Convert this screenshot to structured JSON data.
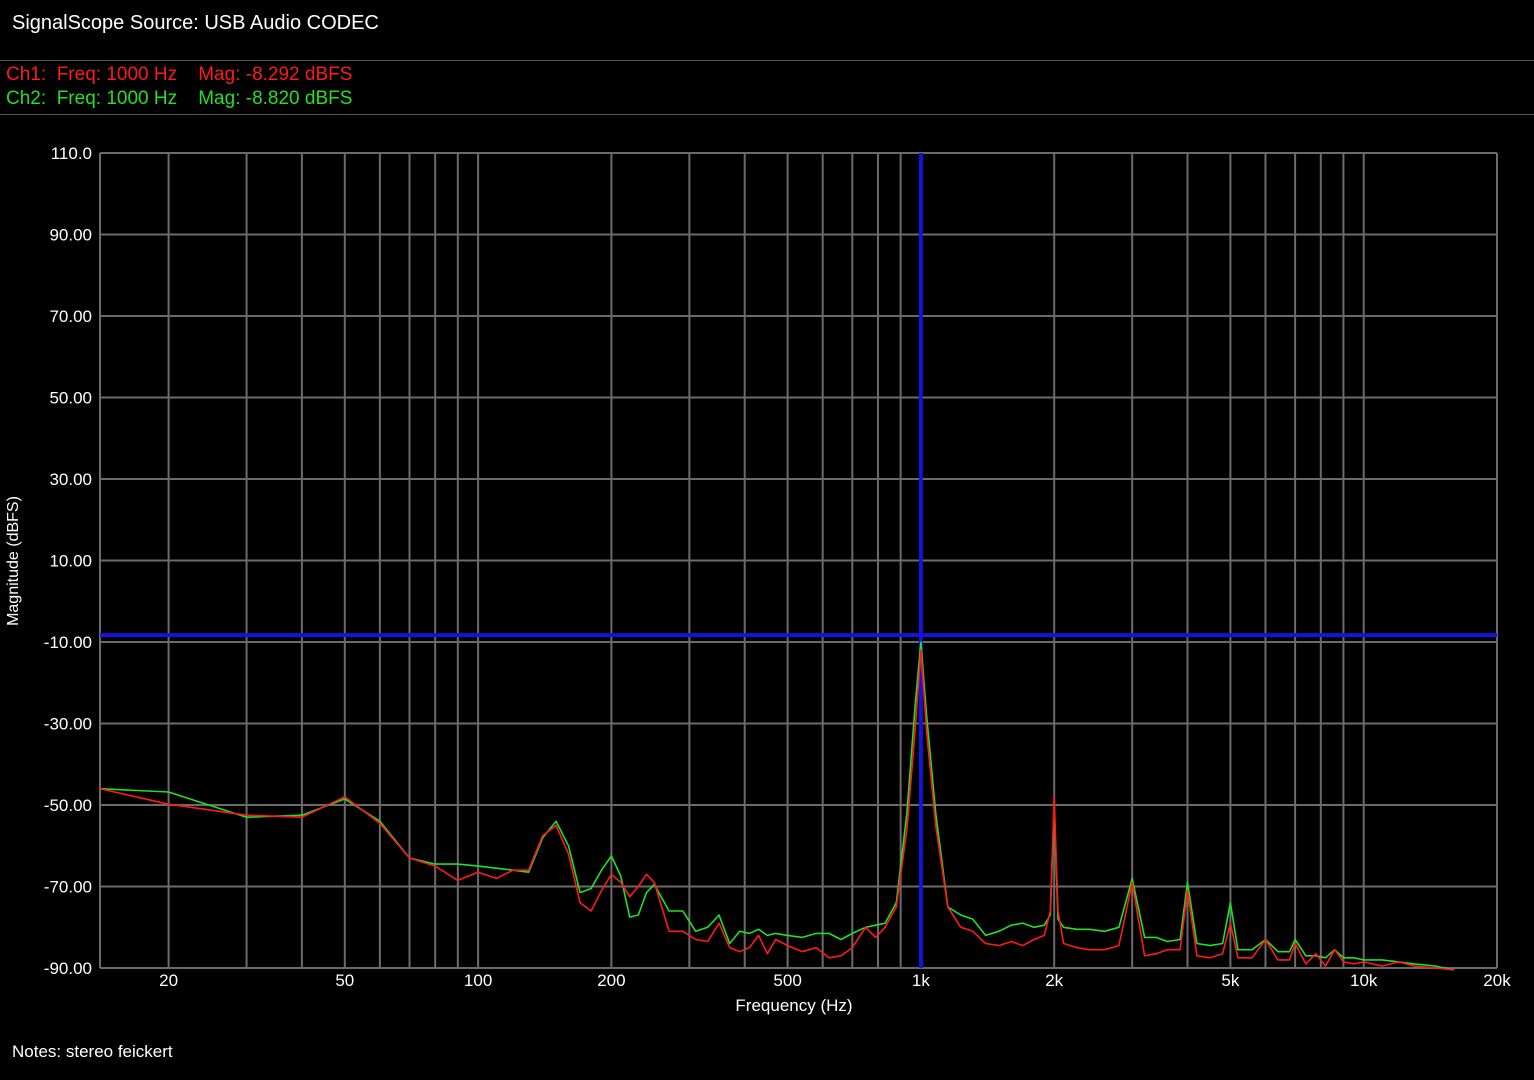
{
  "header": {
    "title": "SignalScope Source:  USB Audio CODEC"
  },
  "readouts": [
    {
      "channel": "Ch1:",
      "freq": "Freq: 1000 Hz",
      "mag": "Mag: -8.292 dBFS",
      "color": "#ff1a1a"
    },
    {
      "channel": "Ch2:",
      "freq": "Freq: 1000 Hz",
      "mag": "Mag: -8.820 dBFS",
      "color": "#22e022"
    }
  ],
  "notes": "Notes: stereo feickert",
  "colors": {
    "grid": "#6b6b6b",
    "cursor": "#1515d8",
    "background": "#000000"
  },
  "chart_data": {
    "type": "line",
    "xlabel": "Frequency (Hz)",
    "ylabel": "Magnitude (dBFS)",
    "xscale": "log",
    "xlim": [
      14,
      20000
    ],
    "ylim": [
      -90,
      110
    ],
    "x_ticks": [
      {
        "value": 20,
        "label": "20"
      },
      {
        "value": 50,
        "label": "50"
      },
      {
        "value": 100,
        "label": "100"
      },
      {
        "value": 200,
        "label": "200"
      },
      {
        "value": 500,
        "label": "500"
      },
      {
        "value": 1000,
        "label": "1k"
      },
      {
        "value": 2000,
        "label": "2k"
      },
      {
        "value": 5000,
        "label": "5k"
      },
      {
        "value": 10000,
        "label": "10k"
      },
      {
        "value": 20000,
        "label": "20k"
      }
    ],
    "y_ticks": [
      {
        "value": 110,
        "label": "110.0"
      },
      {
        "value": 90,
        "label": "90.00"
      },
      {
        "value": 70,
        "label": "70.00"
      },
      {
        "value": 50,
        "label": "50.00"
      },
      {
        "value": 30,
        "label": "30.00"
      },
      {
        "value": 10,
        "label": "10.00"
      },
      {
        "value": -10,
        "label": "-10.00"
      },
      {
        "value": -30,
        "label": "-30.00"
      },
      {
        "value": -50,
        "label": "-50.00"
      },
      {
        "value": -70,
        "label": "-70.00"
      },
      {
        "value": -90,
        "label": "-90.00"
      }
    ],
    "grid": true,
    "cursor": {
      "x": 1000,
      "y": -8.3
    },
    "series": [
      {
        "name": "Ch1",
        "color": "#ff1a1a",
        "points": [
          [
            14,
            -46
          ],
          [
            20,
            -49.8
          ],
          [
            30,
            -52.5
          ],
          [
            40,
            -53
          ],
          [
            50,
            -48
          ],
          [
            60,
            -54.5
          ],
          [
            70,
            -63
          ],
          [
            80,
            -65
          ],
          [
            90,
            -68.5
          ],
          [
            100,
            -66.5
          ],
          [
            110,
            -68
          ],
          [
            120,
            -66
          ],
          [
            130,
            -66
          ],
          [
            140,
            -57.5
          ],
          [
            150,
            -55
          ],
          [
            160,
            -62
          ],
          [
            170,
            -74
          ],
          [
            180,
            -76
          ],
          [
            190,
            -71
          ],
          [
            200,
            -67
          ],
          [
            210,
            -69
          ],
          [
            220,
            -72.5
          ],
          [
            230,
            -70
          ],
          [
            240,
            -67
          ],
          [
            250,
            -69
          ],
          [
            270,
            -81
          ],
          [
            290,
            -81
          ],
          [
            310,
            -83
          ],
          [
            330,
            -83.5
          ],
          [
            350,
            -79
          ],
          [
            370,
            -85
          ],
          [
            390,
            -86
          ],
          [
            410,
            -85
          ],
          [
            430,
            -82
          ],
          [
            450,
            -86.5
          ],
          [
            470,
            -83
          ],
          [
            500,
            -84.5
          ],
          [
            540,
            -86
          ],
          [
            580,
            -85
          ],
          [
            620,
            -87.5
          ],
          [
            660,
            -87
          ],
          [
            700,
            -85
          ],
          [
            750,
            -80
          ],
          [
            790,
            -82.5
          ],
          [
            830,
            -80
          ],
          [
            880,
            -75
          ],
          [
            930,
            -56
          ],
          [
            970,
            -32
          ],
          [
            1000,
            -12
          ],
          [
            1030,
            -32
          ],
          [
            1080,
            -55
          ],
          [
            1150,
            -75
          ],
          [
            1230,
            -80
          ],
          [
            1310,
            -81
          ],
          [
            1400,
            -84
          ],
          [
            1500,
            -84.5
          ],
          [
            1600,
            -83.5
          ],
          [
            1700,
            -84.5
          ],
          [
            1800,
            -83
          ],
          [
            1900,
            -82
          ],
          [
            1960,
            -76
          ],
          [
            2000,
            -48
          ],
          [
            2040,
            -76
          ],
          [
            2100,
            -84
          ],
          [
            2250,
            -85
          ],
          [
            2400,
            -85.5
          ],
          [
            2600,
            -85.5
          ],
          [
            2800,
            -84.5
          ],
          [
            3000,
            -69
          ],
          [
            3200,
            -87
          ],
          [
            3400,
            -86.5
          ],
          [
            3600,
            -85.5
          ],
          [
            3850,
            -85.5
          ],
          [
            4000,
            -71
          ],
          [
            4200,
            -87
          ],
          [
            4500,
            -87.5
          ],
          [
            4800,
            -86.5
          ],
          [
            5000,
            -79
          ],
          [
            5200,
            -87.5
          ],
          [
            5600,
            -87.5
          ],
          [
            6000,
            -83
          ],
          [
            6400,
            -88
          ],
          [
            6800,
            -88
          ],
          [
            7000,
            -84
          ],
          [
            7400,
            -89
          ],
          [
            7800,
            -86.5
          ],
          [
            8200,
            -89.5
          ],
          [
            8600,
            -85.5
          ],
          [
            9000,
            -88.5
          ],
          [
            9500,
            -89
          ],
          [
            10000,
            -88.5
          ],
          [
            11000,
            -89.5
          ],
          [
            12000,
            -88.5
          ],
          [
            13000,
            -89.5
          ],
          [
            14500,
            -90
          ],
          [
            16000,
            -90.5
          ]
        ]
      },
      {
        "name": "Ch2",
        "color": "#22e022",
        "points": [
          [
            14,
            -46
          ],
          [
            20,
            -46.8
          ],
          [
            30,
            -53
          ],
          [
            40,
            -52.5
          ],
          [
            50,
            -48.5
          ],
          [
            60,
            -54
          ],
          [
            70,
            -63
          ],
          [
            80,
            -64.5
          ],
          [
            90,
            -64.5
          ],
          [
            100,
            -65
          ],
          [
            110,
            -65.5
          ],
          [
            120,
            -66
          ],
          [
            130,
            -66.5
          ],
          [
            140,
            -58
          ],
          [
            150,
            -54
          ],
          [
            160,
            -60
          ],
          [
            170,
            -71.5
          ],
          [
            180,
            -70.5
          ],
          [
            190,
            -66
          ],
          [
            200,
            -62.5
          ],
          [
            210,
            -67.5
          ],
          [
            220,
            -77.5
          ],
          [
            230,
            -77
          ],
          [
            240,
            -71.5
          ],
          [
            250,
            -69.5
          ],
          [
            270,
            -76
          ],
          [
            290,
            -76
          ],
          [
            310,
            -81
          ],
          [
            330,
            -80
          ],
          [
            350,
            -77
          ],
          [
            370,
            -84
          ],
          [
            390,
            -81
          ],
          [
            410,
            -81.5
          ],
          [
            430,
            -80.5
          ],
          [
            450,
            -82
          ],
          [
            470,
            -81.5
          ],
          [
            500,
            -82
          ],
          [
            540,
            -82.5
          ],
          [
            580,
            -81.5
          ],
          [
            620,
            -81.5
          ],
          [
            660,
            -83
          ],
          [
            700,
            -81.5
          ],
          [
            750,
            -80
          ],
          [
            790,
            -79.5
          ],
          [
            830,
            -79
          ],
          [
            880,
            -74
          ],
          [
            930,
            -52
          ],
          [
            970,
            -26
          ],
          [
            1000,
            -10
          ],
          [
            1030,
            -28
          ],
          [
            1080,
            -52
          ],
          [
            1150,
            -75
          ],
          [
            1230,
            -77
          ],
          [
            1310,
            -78
          ],
          [
            1400,
            -82
          ],
          [
            1500,
            -81
          ],
          [
            1600,
            -79.5
          ],
          [
            1700,
            -79
          ],
          [
            1800,
            -80
          ],
          [
            1900,
            -79.5
          ],
          [
            1960,
            -77
          ],
          [
            2000,
            -50
          ],
          [
            2040,
            -78
          ],
          [
            2100,
            -80
          ],
          [
            2250,
            -80.5
          ],
          [
            2400,
            -80.5
          ],
          [
            2600,
            -81
          ],
          [
            2800,
            -80
          ],
          [
            3000,
            -68
          ],
          [
            3200,
            -82.5
          ],
          [
            3400,
            -82.5
          ],
          [
            3600,
            -83.5
          ],
          [
            3850,
            -83
          ],
          [
            4000,
            -69
          ],
          [
            4200,
            -84
          ],
          [
            4500,
            -84.5
          ],
          [
            4800,
            -84
          ],
          [
            5000,
            -74
          ],
          [
            5200,
            -85.5
          ],
          [
            5600,
            -85.5
          ],
          [
            6000,
            -83
          ],
          [
            6400,
            -86
          ],
          [
            6800,
            -86
          ],
          [
            7000,
            -83
          ],
          [
            7400,
            -87
          ],
          [
            7800,
            -87
          ],
          [
            8200,
            -87.5
          ],
          [
            8600,
            -85.5
          ],
          [
            9000,
            -87.5
          ],
          [
            9500,
            -87.5
          ],
          [
            10000,
            -88
          ],
          [
            11000,
            -88
          ],
          [
            12000,
            -88.5
          ],
          [
            13000,
            -89
          ],
          [
            14500,
            -89.5
          ],
          [
            16000,
            -90.5
          ]
        ]
      }
    ]
  }
}
